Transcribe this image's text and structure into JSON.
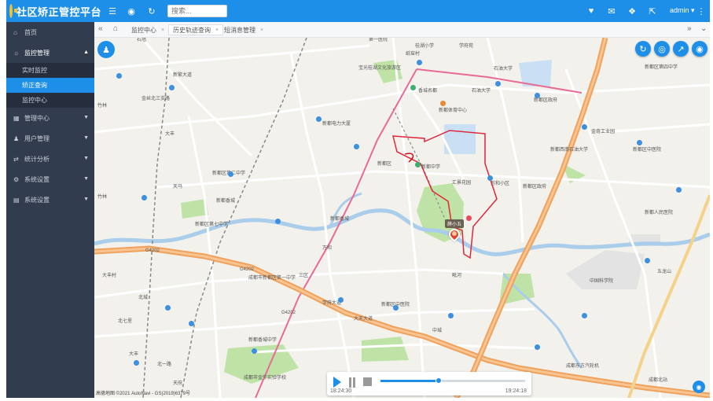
{
  "header": {
    "title": "社区矫正管控平台",
    "search_placeholder": "搜索...",
    "user": "admin ▾",
    "icons": [
      "menu-icon",
      "globe-icon",
      "refresh-icon",
      "bell-icon",
      "message-icon",
      "tag-icon",
      "fullscreen-icon",
      "more-icon"
    ]
  },
  "sidebar": {
    "items": [
      {
        "label": "首页",
        "icon": "home-icon"
      },
      {
        "label": "监控管理",
        "icon": "monitor-icon",
        "expanded": true,
        "children": [
          {
            "label": "实时监控",
            "active": false
          },
          {
            "label": "矫正查询",
            "active": true
          },
          {
            "label": "监控中心",
            "active": false
          }
        ]
      },
      {
        "label": "管理中心",
        "icon": "manage-icon"
      },
      {
        "label": "用户管理",
        "icon": "user-icon"
      },
      {
        "label": "统计分析",
        "icon": "stats-icon"
      },
      {
        "label": "系统设置",
        "icon": "gear-icon"
      },
      {
        "label": "系统设置",
        "icon": "doc-icon"
      }
    ]
  },
  "tabs": [
    {
      "label": "监控中心",
      "active": false
    },
    {
      "label": "历史轨迹查询",
      "active": true
    },
    {
      "label": "短消息管理",
      "active": false
    }
  ],
  "map": {
    "marker_label": "薛小五",
    "controls": [
      "refresh-icon",
      "locate-icon",
      "trend-icon",
      "bike-icon"
    ],
    "copyright": "高德地图 ©2021 AutoNavi - GS(2019)6379号",
    "route_color": "#e0263a",
    "labels": {
      "l1": "石墙",
      "l2": "第一医院",
      "l3": "纸窑村",
      "l4": "桂湖小学",
      "l5": "学府苑",
      "l6": "宝光桂湖文化旅游区",
      "l7": "香城名都",
      "l8": "新都体育中心",
      "l9": "石油大学",
      "l10": "新都区政府",
      "l11": "金奇工业园",
      "l12": "新都电力大厦",
      "l13": "新都区",
      "l14": "新都中学",
      "l15": "汇景花园",
      "l16": "万和小区",
      "l17": "新都区政府",
      "l18": "三区",
      "l19": "成都市新都区第一中学",
      "l20": "天府",
      "l21": "新都香城中学",
      "l22": "金丝北三支路",
      "l23": "竹林",
      "l24": "竹林",
      "l25": "大丰",
      "l26": "新都区第七中学",
      "l27": "五龙山",
      "l28": "成都北站",
      "l29": "成都市金牛实验学校",
      "l30": "万和",
      "l31": "北七里",
      "l32": "中国科学院",
      "l33": "学府大道",
      "l34": "新繁大道",
      "l35": "新都区第二中学",
      "l36": "新都区中医院",
      "l37": "新都人民医院",
      "l38": "G4202",
      "l39": "G4202",
      "l40": "G4202",
      "l41": "北城",
      "l42": "大丰村",
      "l43": "北一路",
      "l44": "中城",
      "l45": "石油大学",
      "l46": "毗河",
      "l47": "新都香城",
      "l48": "大丰",
      "l49": "新都区中医院",
      "l50": "成都东方汽轮机",
      "l51": "新都区第四中学",
      "l52": "新都香城",
      "l53": "新都西南石油大学",
      "l54": "大天大道",
      "l55": "天马"
    }
  },
  "player": {
    "start_time": "18:24:30",
    "end_time": "19:24:18",
    "progress": 0.4
  }
}
